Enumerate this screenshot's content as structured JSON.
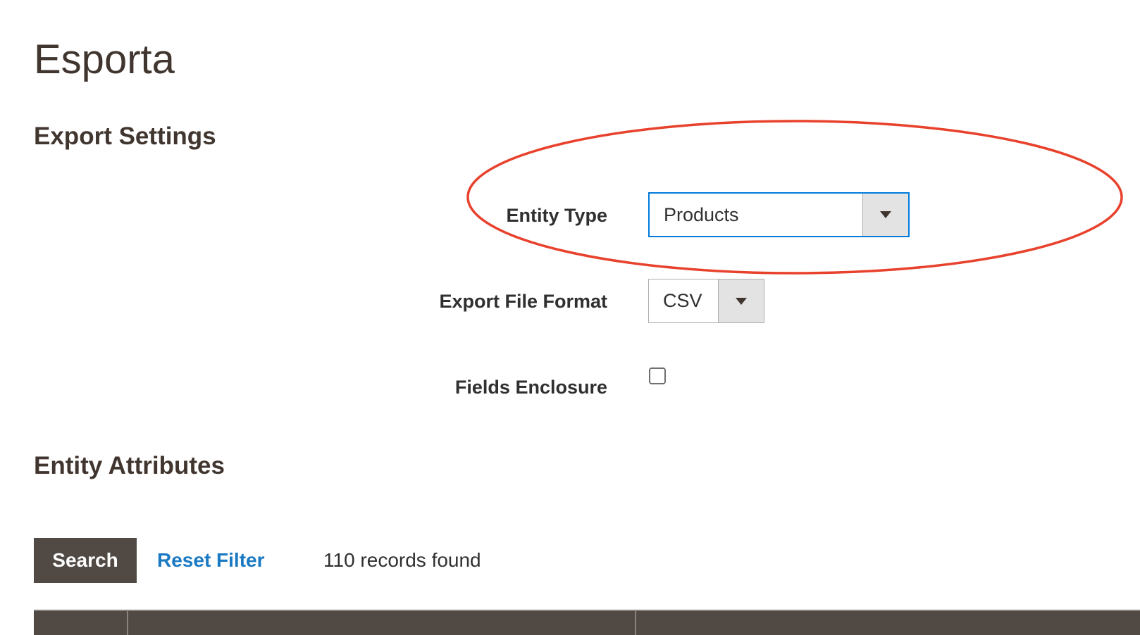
{
  "page": {
    "title": "Esporta"
  },
  "export_settings": {
    "heading": "Export Settings",
    "entity_type": {
      "label": "Entity Type",
      "value": "Products"
    },
    "file_format": {
      "label": "Export File Format",
      "value": "CSV"
    },
    "fields_enclosure": {
      "label": "Fields Enclosure",
      "checked": false
    }
  },
  "entity_attributes": {
    "heading": "Entity Attributes",
    "search_label": "Search",
    "reset_label": "Reset Filter",
    "records_text": "110 records found"
  },
  "colors": {
    "annotation": "#e8412c",
    "focus_border": "#007bdb",
    "link": "#1979c3",
    "primary_button": "#514943"
  }
}
